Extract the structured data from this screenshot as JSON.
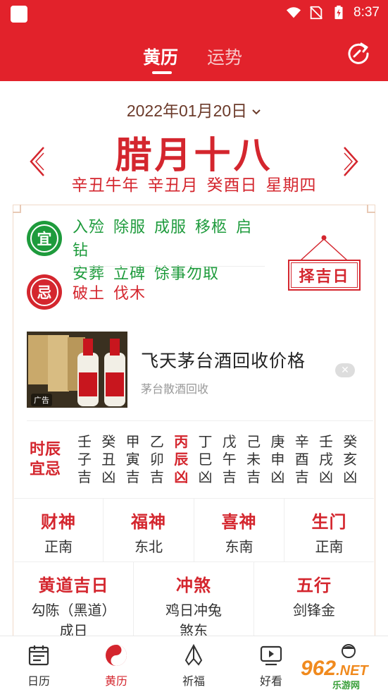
{
  "status_bar": {
    "time": "8:37"
  },
  "header": {
    "tabs": [
      {
        "label": "黄历",
        "active": true
      },
      {
        "label": "运势",
        "active": false
      }
    ],
    "accent_color": "#e2222b"
  },
  "date": {
    "gregorian": "2022年01月20日",
    "lunar": "腊月十八",
    "ganzhi": [
      "辛丑牛年",
      "辛丑月",
      "癸酉日",
      "星期四"
    ]
  },
  "yi": {
    "badge": "宜",
    "items": [
      "入殓",
      "除服",
      "成服",
      "移柩",
      "启钻",
      "安葬",
      "立碑",
      "馀事勿取"
    ]
  },
  "ji": {
    "badge": "忌",
    "items": [
      "破土",
      "伐木"
    ]
  },
  "zeji_button": "择吉日",
  "ad": {
    "badge": "广告",
    "title": "飞天茅台酒回收价格",
    "subtitle": "茅台散酒回收",
    "close_symbol": "✕"
  },
  "shichen": {
    "label_line1": "时辰",
    "label_line2": "宜忌",
    "columns": [
      {
        "stem": "壬",
        "branch": "子",
        "luck": "吉",
        "current": false
      },
      {
        "stem": "癸",
        "branch": "丑",
        "luck": "凶",
        "current": false
      },
      {
        "stem": "甲",
        "branch": "寅",
        "luck": "吉",
        "current": false
      },
      {
        "stem": "乙",
        "branch": "卯",
        "luck": "吉",
        "current": false
      },
      {
        "stem": "丙",
        "branch": "辰",
        "luck": "凶",
        "current": true
      },
      {
        "stem": "丁",
        "branch": "巳",
        "luck": "凶",
        "current": false
      },
      {
        "stem": "戊",
        "branch": "午",
        "luck": "吉",
        "current": false
      },
      {
        "stem": "己",
        "branch": "未",
        "luck": "吉",
        "current": false
      },
      {
        "stem": "庚",
        "branch": "申",
        "luck": "凶",
        "current": false
      },
      {
        "stem": "辛",
        "branch": "酉",
        "luck": "吉",
        "current": false
      },
      {
        "stem": "壬",
        "branch": "戌",
        "luck": "凶",
        "current": false
      },
      {
        "stem": "癸",
        "branch": "亥",
        "luck": "凶",
        "current": false
      }
    ]
  },
  "gods": [
    {
      "title": "财神",
      "value": "正南"
    },
    {
      "title": "福神",
      "value": "东北"
    },
    {
      "title": "喜神",
      "value": "东南"
    },
    {
      "title": "生门",
      "value": "正南"
    }
  ],
  "details": [
    {
      "title": "黄道吉日",
      "line1": "勾陈（黑道）",
      "line2": "成日"
    },
    {
      "title": "冲煞",
      "line1": "鸡日冲兔",
      "line2": "煞东"
    },
    {
      "title": "五行",
      "line1": "剑锋金",
      "line2": ""
    }
  ],
  "bottom_nav": [
    {
      "label": "日历",
      "icon": "calendar-icon",
      "active": false
    },
    {
      "label": "黄历",
      "icon": "yin-yang-icon",
      "active": true
    },
    {
      "label": "祈福",
      "icon": "praying-hands-icon",
      "active": false
    },
    {
      "label": "好看",
      "icon": "video-play-icon",
      "active": false
    }
  ],
  "watermark": {
    "text": "962",
    "suffix": ".NET",
    "sub": "乐游网"
  }
}
